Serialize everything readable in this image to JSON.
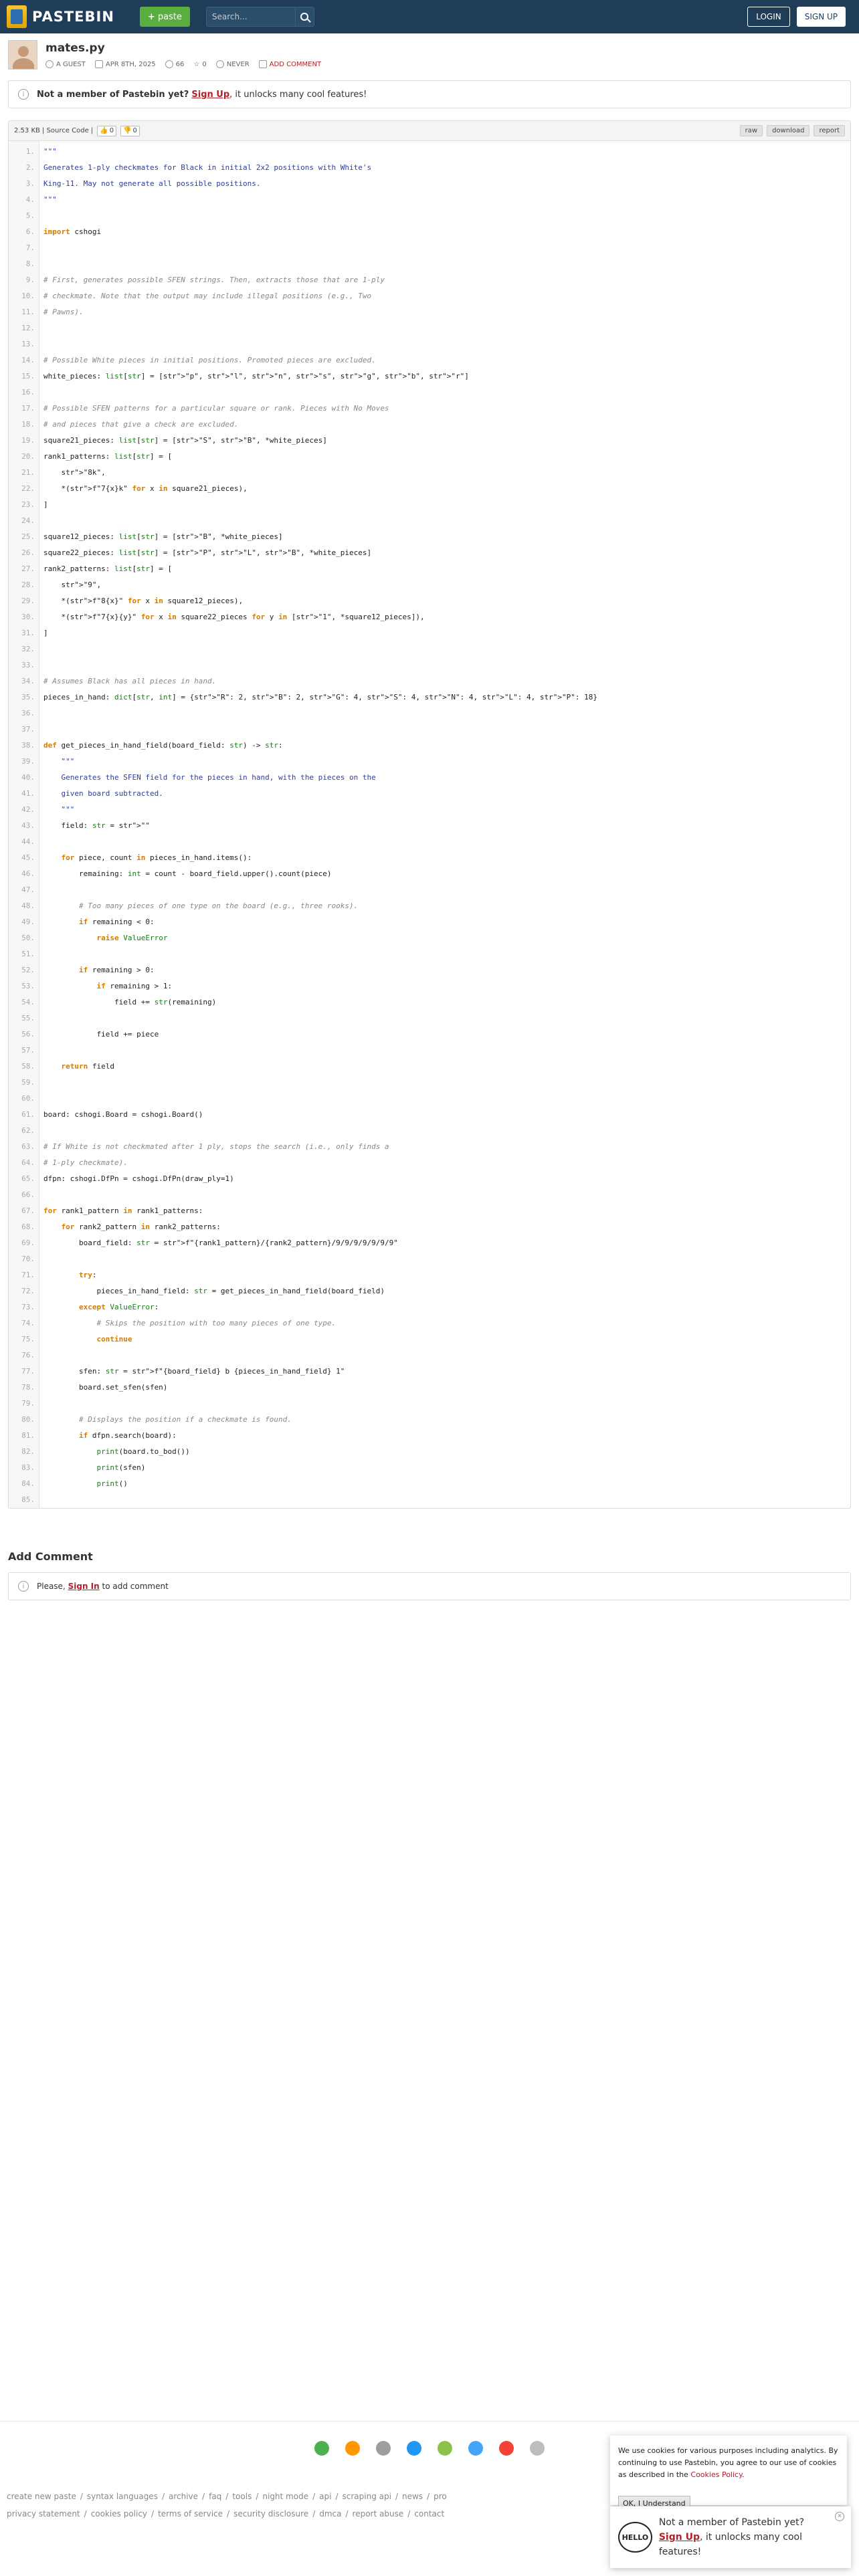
{
  "header": {
    "logo_text": "PASTEBIN",
    "paste_button": "paste",
    "search_placeholder": "Search...",
    "login": "LOGIN",
    "signup": "SIGN UP"
  },
  "paste": {
    "title": "mates.py",
    "author": "A GUEST",
    "date": "APR 8TH, 2025",
    "views": "66",
    "stars": "0",
    "expire": "NEVER",
    "add_comment": "ADD COMMENT"
  },
  "notice": {
    "bold": "Not a member of Pastebin yet?",
    "link": "Sign Up",
    "rest": ", it unlocks many cool features!"
  },
  "code_toolbar": {
    "info": "2.53 KB | Source Code |",
    "likes": "0",
    "dislikes": "0",
    "raw": "raw",
    "download": "download",
    "report": "report"
  },
  "code_lines": [
    "\"\"\"",
    "Generates 1-ply checkmates for Black in initial 2x2 positions with White's",
    "King-11. May not generate all possible positions.",
    "\"\"\"",
    "",
    "import cshogi",
    "",
    "",
    "# First, generates possible SFEN strings. Then, extracts those that are 1-ply",
    "# checkmate. Note that the output may include illegal positions (e.g., Two",
    "# Pawns).",
    "",
    "",
    "# Possible White pieces in initial positions. Promoted pieces are excluded.",
    "white_pieces: list[str] = [\"p\", \"l\", \"n\", \"s\", \"g\", \"b\", \"r\"]",
    "",
    "# Possible SFEN patterns for a particular square or rank. Pieces with No Moves",
    "# and pieces that give a check are excluded.",
    "square21_pieces: list[str] = [\"S\", \"B\", *white_pieces]",
    "rank1_patterns: list[str] = [",
    "    \"8k\",",
    "    *(f\"7{x}k\" for x in square21_pieces),",
    "]",
    "",
    "square12_pieces: list[str] = [\"B\", *white_pieces]",
    "square22_pieces: list[str] = [\"P\", \"L\", \"B\", *white_pieces]",
    "rank2_patterns: list[str] = [",
    "    \"9\",",
    "    *(f\"8{x}\" for x in square12_pieces),",
    "    *(f\"7{x}{y}\" for x in square22_pieces for y in [\"1\", *square12_pieces]),",
    "]",
    "",
    "",
    "# Assumes Black has all pieces in hand.",
    "pieces_in_hand: dict[str, int] = {\"R\": 2, \"B\": 2, \"G\": 4, \"S\": 4, \"N\": 4, \"L\": 4, \"P\": 18}",
    "",
    "",
    "def get_pieces_in_hand_field(board_field: str) -> str:",
    "    \"\"\"",
    "    Generates the SFEN field for the pieces in hand, with the pieces on the",
    "    given board subtracted.",
    "    \"\"\"",
    "    field: str = \"\"",
    "",
    "    for piece, count in pieces_in_hand.items():",
    "        remaining: int = count - board_field.upper().count(piece)",
    "",
    "        # Too many pieces of one type on the board (e.g., three rooks).",
    "        if remaining < 0:",
    "            raise ValueError",
    "",
    "        if remaining > 0:",
    "            if remaining > 1:",
    "                field += str(remaining)",
    "",
    "            field += piece",
    "",
    "    return field",
    "",
    "",
    "board: cshogi.Board = cshogi.Board()",
    "",
    "# If White is not checkmated after 1 ply, stops the search (i.e., only finds a",
    "# 1-ply checkmate).",
    "dfpn: cshogi.DfPn = cshogi.DfPn(draw_ply=1)",
    "",
    "for rank1_pattern in rank1_patterns:",
    "    for rank2_pattern in rank2_patterns:",
    "        board_field: str = f\"{rank1_pattern}/{rank2_pattern}/9/9/9/9/9/9/9\"",
    "",
    "        try:",
    "            pieces_in_hand_field: str = get_pieces_in_hand_field(board_field)",
    "        except ValueError:",
    "            # Skips the position with too many pieces of one type.",
    "            continue",
    "",
    "        sfen: str = f\"{board_field} b {pieces_in_hand_field} 1\"",
    "        board.set_sfen(sfen)",
    "",
    "        # Displays the position if a checkmate is found.",
    "        if dfpn.search(board):",
    "            print(board.to_bod())",
    "            print(sfen)",
    "            print()",
    ""
  ],
  "comments": {
    "title": "Add Comment",
    "please": "Please,",
    "sign_in": "Sign In",
    "rest": "to add comment"
  },
  "footer": {
    "links_row1": [
      "create new paste",
      "syntax languages",
      "archive",
      "faq",
      "tools",
      "night mode",
      "api",
      "scraping api",
      "news",
      "pro"
    ],
    "links_row2": [
      "privacy statement",
      "cookies policy",
      "terms of service",
      "security disclosure",
      "dmca",
      "report abuse",
      "contact"
    ],
    "icon_colors": [
      "#4caf50",
      "#ff9800",
      "#9e9e9e",
      "#2196f3",
      "#8bc34a",
      "#42a5f5",
      "#f44336",
      "#bdbdbd"
    ]
  },
  "cookie": {
    "text": "We use cookies for various purposes including analytics. By continuing to use Pastebin, you agree to our use of cookies as described in the",
    "link": "Cookies Policy",
    "button": "OK, I Understand"
  },
  "promo": {
    "hello": "HELLO",
    "text1": "Not a member of Pastebin yet?",
    "link": "Sign Up",
    "text2": ", it unlocks many cool features!"
  }
}
